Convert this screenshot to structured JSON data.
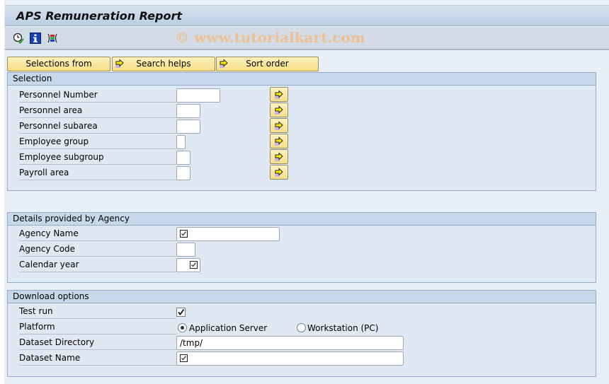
{
  "window": {
    "title": "APS Remuneration Report",
    "watermark": "© www.tutorialkart.com"
  },
  "toolbar": {
    "icons": [
      "execute-clock-icon",
      "info-icon",
      "selection-options-icon"
    ]
  },
  "buttons": {
    "selections_from": "Selections from",
    "search_helps": "Search helps",
    "sort_order": "Sort order"
  },
  "selection": {
    "header": "Selection",
    "rows": [
      {
        "label": "Personnel Number",
        "value": ""
      },
      {
        "label": "Personnel area",
        "value": ""
      },
      {
        "label": "Personnel subarea",
        "value": ""
      },
      {
        "label": "Employee group",
        "value": ""
      },
      {
        "label": "Employee subgroup",
        "value": ""
      },
      {
        "label": "Payroll area",
        "value": ""
      }
    ]
  },
  "agency": {
    "header": "Details provided by Agency",
    "rows": [
      {
        "label": "Agency Name",
        "value": "",
        "required": true
      },
      {
        "label": "Agency Code",
        "value": "",
        "required": false
      },
      {
        "label": "Calendar year",
        "value": "",
        "required": true
      }
    ]
  },
  "download": {
    "header": "Download options",
    "test_run_label": "Test run",
    "test_run_checked": true,
    "platform_label": "Platform",
    "platform_options": [
      "Application Server",
      "Workstation (PC)"
    ],
    "platform_selected": "Application Server",
    "directory_label": "Dataset Directory",
    "directory_value": "/tmp/",
    "name_label": "Dataset Name",
    "name_value": "",
    "name_required": true
  }
}
